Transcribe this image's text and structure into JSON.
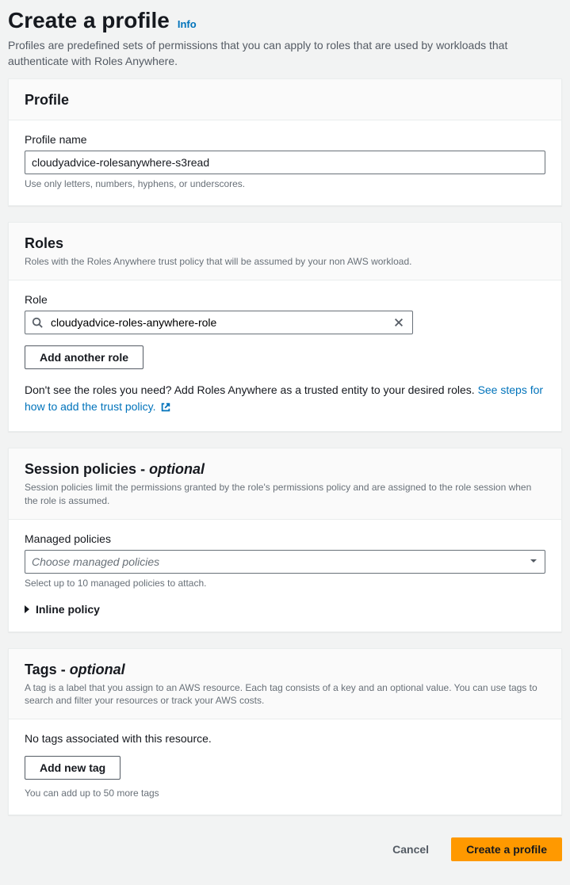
{
  "header": {
    "title": "Create a profile",
    "info_label": "Info",
    "description": "Profiles are predefined sets of permissions that you can apply to roles that are used by workloads that authenticate with Roles Anywhere."
  },
  "profile": {
    "panel_title": "Profile",
    "name_label": "Profile name",
    "name_value": "cloudyadvice-rolesanywhere-s3read",
    "name_helper": "Use only letters, numbers, hyphens, or underscores."
  },
  "roles": {
    "panel_title": "Roles",
    "panel_sub": "Roles with the Roles Anywhere trust policy that will be assumed by your non AWS workload.",
    "role_label": "Role",
    "role_value": "cloudyadvice-roles-anywhere-role",
    "add_another_label": "Add another role",
    "note_prefix": "Don't see the roles you need? Add Roles Anywhere as a trusted entity to your desired roles. ",
    "note_link": "See steps for how to add the trust policy."
  },
  "session": {
    "panel_title": "Session policies",
    "optional_text": "optional",
    "panel_sub": "Session policies limit the permissions granted by the role's permissions policy and are assigned to the role session when the role is assumed.",
    "managed_label": "Managed policies",
    "managed_placeholder": "Choose managed policies",
    "managed_helper": "Select up to 10 managed policies to attach.",
    "inline_label": "Inline policy"
  },
  "tags": {
    "panel_title": "Tags",
    "optional_text": "optional",
    "panel_sub": "A tag is a label that you assign to an AWS resource. Each tag consists of a key and an optional value. You can use tags to search and filter your resources or track your AWS costs.",
    "empty_text": "No tags associated with this resource.",
    "add_label": "Add new tag",
    "limit_text": "You can add up to 50 more tags"
  },
  "footer": {
    "cancel_label": "Cancel",
    "submit_label": "Create a profile"
  }
}
